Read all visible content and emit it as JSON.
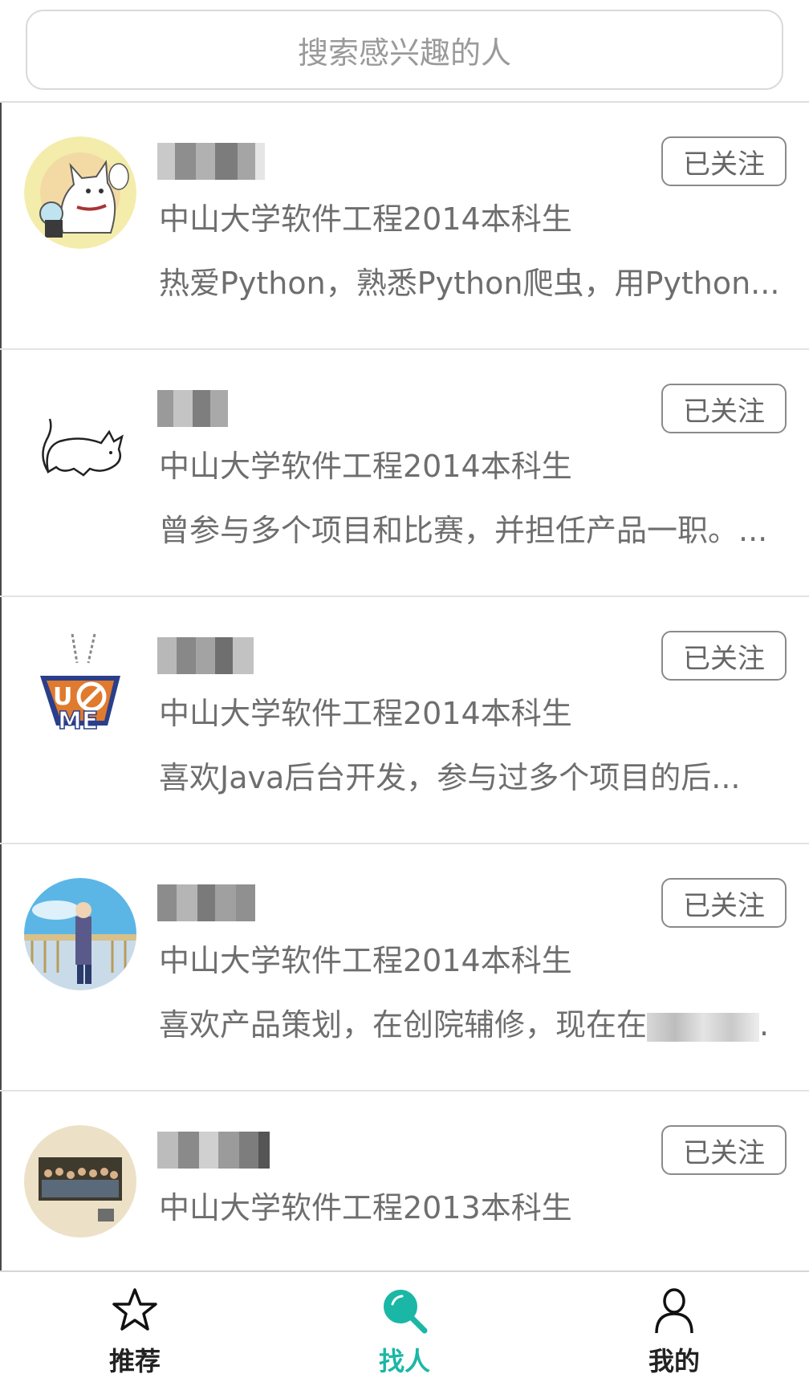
{
  "search": {
    "placeholder": "搜索感兴趣的人"
  },
  "people": [
    {
      "school": "中山大学软件工程2014本科生",
      "bio": "热爱Python，熟悉Python爬虫，用Python...",
      "follow_label": "已关注"
    },
    {
      "school": "中山大学软件工程2014本科生",
      "bio": "曾参与多个项目和比赛，并担任产品一职。...",
      "follow_label": "已关注"
    },
    {
      "school": "中山大学软件工程2014本科生",
      "bio": "喜欢Java后台开发，参与过多个项目的后...",
      "follow_label": "已关注"
    },
    {
      "school": "中山大学软件工程2014本科生",
      "bio": "喜欢产品策划，在创院辅修，现在在",
      "bio_tail": ".",
      "follow_label": "已关注"
    },
    {
      "school": "中山大学软件工程2013本科生",
      "bio": "",
      "follow_label": "已关注"
    }
  ],
  "tabbar": {
    "tabs": [
      {
        "label": "推荐",
        "icon": "star-icon"
      },
      {
        "label": "找人",
        "icon": "search-icon"
      },
      {
        "label": "我的",
        "icon": "person-icon"
      }
    ],
    "active_index": 1
  },
  "colors": {
    "accent": "#1ab7a6",
    "text_secondary": "#6e6e6e"
  }
}
